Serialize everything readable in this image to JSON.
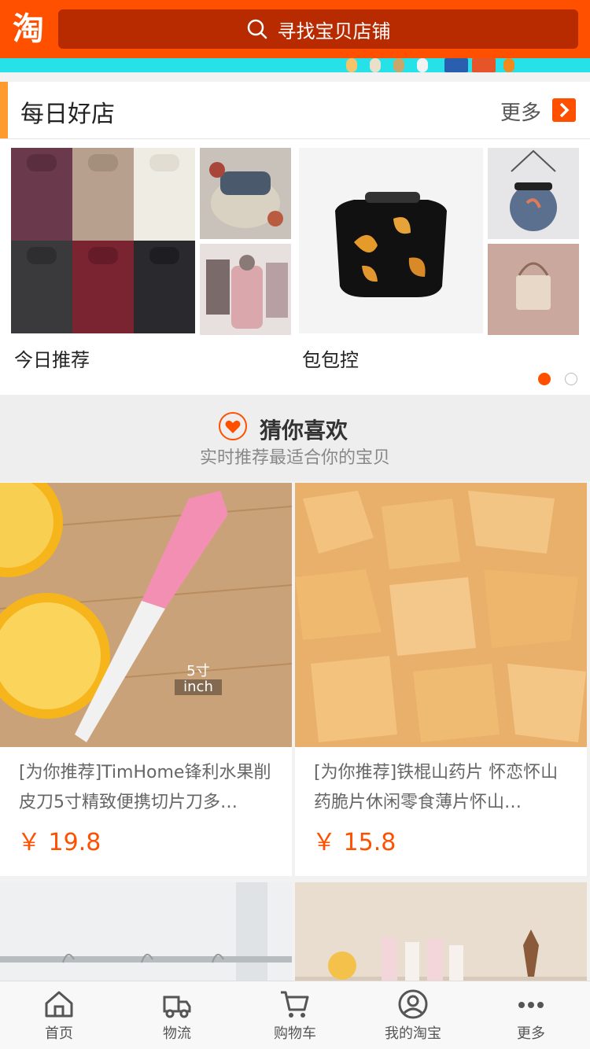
{
  "header": {
    "logo_char": "淘",
    "search_placeholder": "寻找宝贝店铺"
  },
  "daily_shops": {
    "title": "每日好店",
    "more_label": "更多",
    "sections": [
      {
        "label": "今日推荐"
      },
      {
        "label": "包包控"
      }
    ]
  },
  "guess": {
    "title": "猜你喜欢",
    "subtitle": "实时推荐最适合你的宝贝"
  },
  "products": [
    {
      "name": "[为你推荐]TimHome锋利水果削皮刀5寸精致便携切片刀多…",
      "price": "￥ 19.8",
      "overlay_top": "5寸",
      "overlay_bottom": "inch"
    },
    {
      "name": "[为你推荐]铁棍山药片 怀恋怀山药脆片休闲零食薄片怀山…",
      "price": "￥ 15.8"
    },
    {
      "name": "",
      "price": ""
    },
    {
      "name": "",
      "price": ""
    }
  ],
  "tabs": [
    {
      "label": "首页",
      "icon": "home-icon"
    },
    {
      "label": "物流",
      "icon": "truck-icon"
    },
    {
      "label": "购物车",
      "icon": "cart-icon"
    },
    {
      "label": "我的淘宝",
      "icon": "user-icon"
    },
    {
      "label": "更多",
      "icon": "more-dots-icon"
    }
  ],
  "colors": {
    "brand": "#ff5000",
    "search_bg": "#b82a00",
    "accent": "#ff9a2e"
  }
}
